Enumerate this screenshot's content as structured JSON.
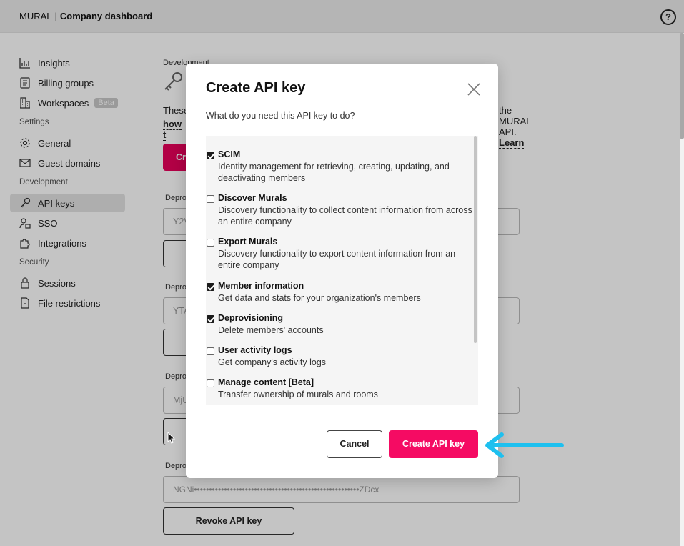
{
  "header": {
    "brand": "MURAL",
    "separator": "|",
    "title": "Company dashboard",
    "help": "?"
  },
  "sidebar": {
    "items": [
      {
        "label": "Insights",
        "icon": "bar-chart-icon"
      },
      {
        "label": "Billing groups",
        "icon": "receipt-icon"
      },
      {
        "label": "Workspaces",
        "icon": "building-icon",
        "badge": "Beta"
      },
      {
        "label": "General",
        "icon": "gear-icon"
      },
      {
        "label": "Guest domains",
        "icon": "envelope-icon"
      },
      {
        "label": "API keys",
        "icon": "key-icon",
        "active": true
      },
      {
        "label": "SSO",
        "icon": "user-lock-icon"
      },
      {
        "label": "Integrations",
        "icon": "puzzle-icon"
      },
      {
        "label": "Sessions",
        "icon": "lock-icon"
      },
      {
        "label": "File restrictions",
        "icon": "file-icon"
      }
    ],
    "sections": [
      "Settings",
      "Development",
      "Security"
    ]
  },
  "main": {
    "section_label": "Development",
    "intro_start": "These",
    "intro_end": "the MURAL API.",
    "learn": "Learn",
    "how_to": "how t",
    "create_btn_partial": "Cr",
    "labels": [
      "Depro",
      "Depro",
      "Depro",
      "Depro"
    ],
    "fields": [
      "Y2V",
      "YTA",
      "MjU",
      "NGNi•••••••••••••••••••••••••••••••••••••••••••••••••••••••ZDcx"
    ],
    "revoke": "Revoke API key"
  },
  "modal": {
    "title": "Create API key",
    "subtitle": "What do you need this API key to do?",
    "options": [
      {
        "name": "SCIM",
        "desc": "Identity management for retrieving, creating, updating, and deactivating members",
        "checked": true
      },
      {
        "name": "Discover Murals",
        "desc": "Discovery functionality to collect content information from across an entire company",
        "checked": false
      },
      {
        "name": "Export Murals",
        "desc": "Discovery functionality to export content information from an entire company",
        "checked": false
      },
      {
        "name": "Member information",
        "desc": "Get data and stats for your organization's members",
        "checked": true
      },
      {
        "name": "Deprovisioning",
        "desc": "Delete members' accounts",
        "checked": true
      },
      {
        "name": "User activity logs",
        "desc": "Get company's activity logs",
        "checked": false
      },
      {
        "name": "Manage content [Beta]",
        "desc": "Transfer ownership of murals and rooms",
        "checked": false
      }
    ],
    "cancel": "Cancel",
    "create": "Create API key"
  },
  "colors": {
    "accent": "#f50b63",
    "arrow": "#1ec0ef"
  }
}
